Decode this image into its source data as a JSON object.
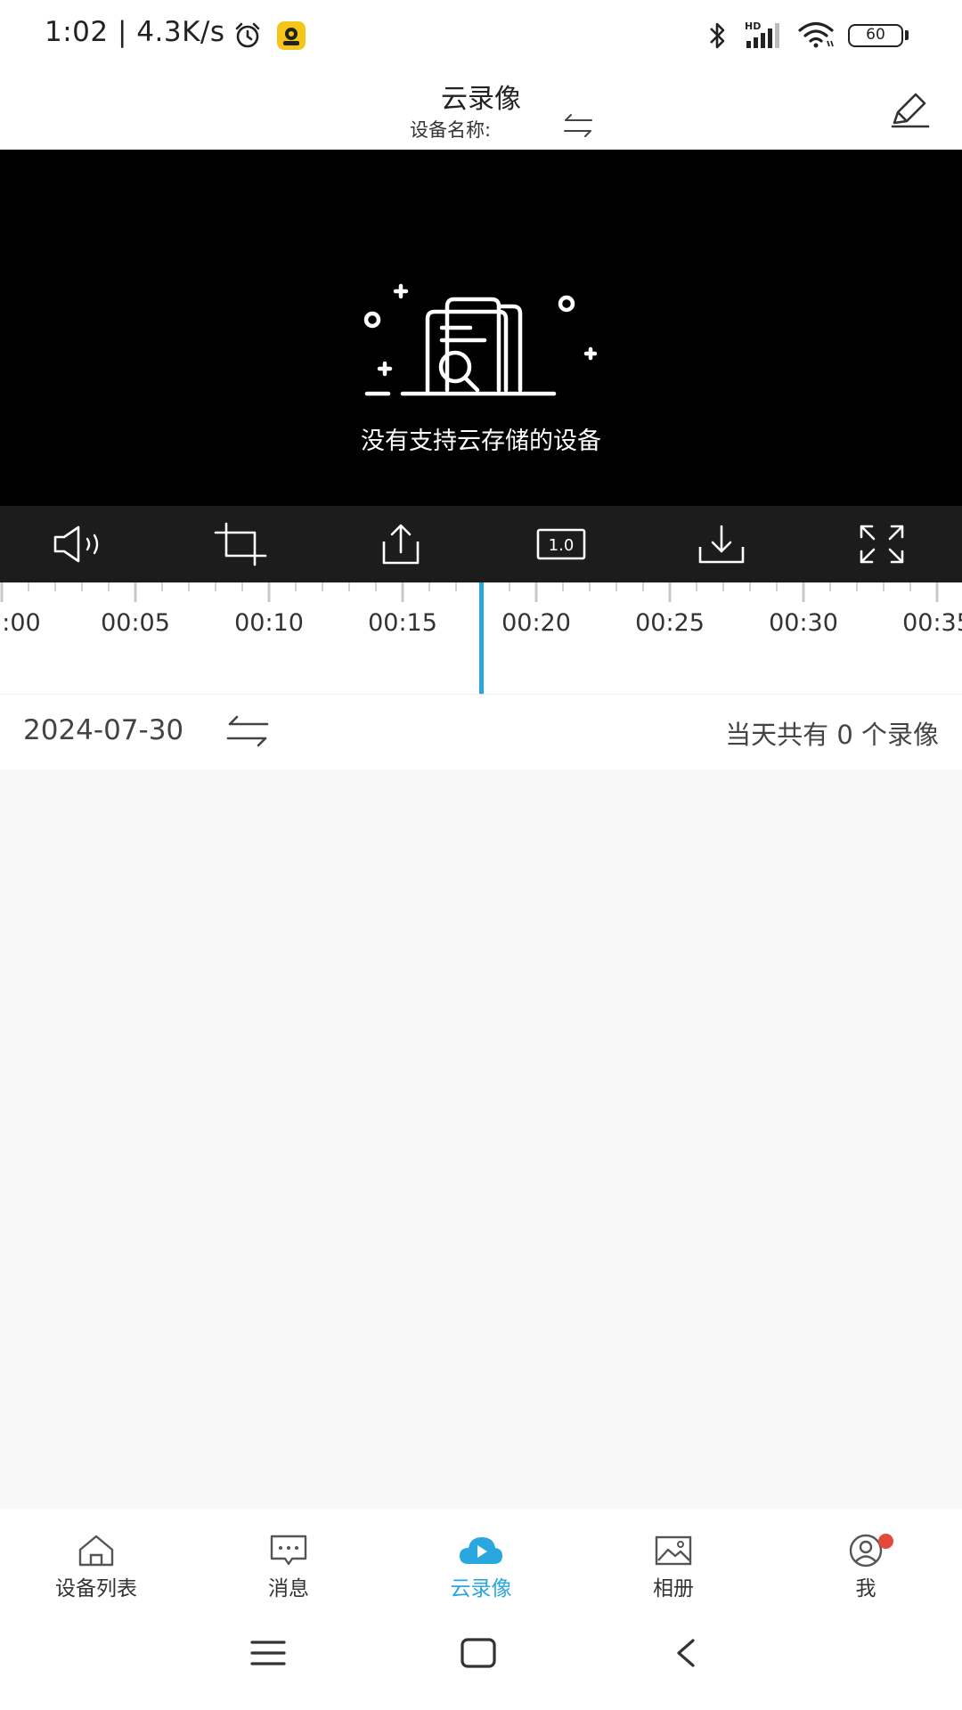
{
  "status_bar": {
    "time_speed": "1:02 | 4.3K/s",
    "battery": "60",
    "icons": [
      "alarm-icon",
      "app-notification-icon",
      "bluetooth-icon",
      "hd-signal-icon",
      "wifi-icon",
      "battery-icon"
    ]
  },
  "header": {
    "title": "云录像",
    "device_label": "设备名称:"
  },
  "video": {
    "empty_message": "没有支持云存储的设备"
  },
  "toolbar": {
    "speed_label": "1.0",
    "tools": [
      "speaker-icon",
      "crop-icon",
      "share-icon",
      "speed-icon",
      "download-icon",
      "fullscreen-icon"
    ]
  },
  "timeline": {
    "labels": [
      ":00",
      "00:05",
      "00:10",
      "00:15",
      "00:20",
      "00:25",
      "00:30",
      "00:35"
    ],
    "cursor_color": "#2ba7e0"
  },
  "date_row": {
    "date": "2024-07-30",
    "count_text": "当天共有 0 个录像"
  },
  "bottom_nav": {
    "items": [
      {
        "label": "设备列表",
        "icon": "home-icon"
      },
      {
        "label": "消息",
        "icon": "message-icon"
      },
      {
        "label": "云录像",
        "icon": "cloud-play-icon",
        "active": true
      },
      {
        "label": "相册",
        "icon": "album-icon"
      },
      {
        "label": "我",
        "icon": "profile-icon"
      }
    ],
    "active_color": "#2ba7e0"
  },
  "system_nav": {
    "icons": [
      "menu-icon",
      "home-square-icon",
      "back-icon"
    ]
  }
}
